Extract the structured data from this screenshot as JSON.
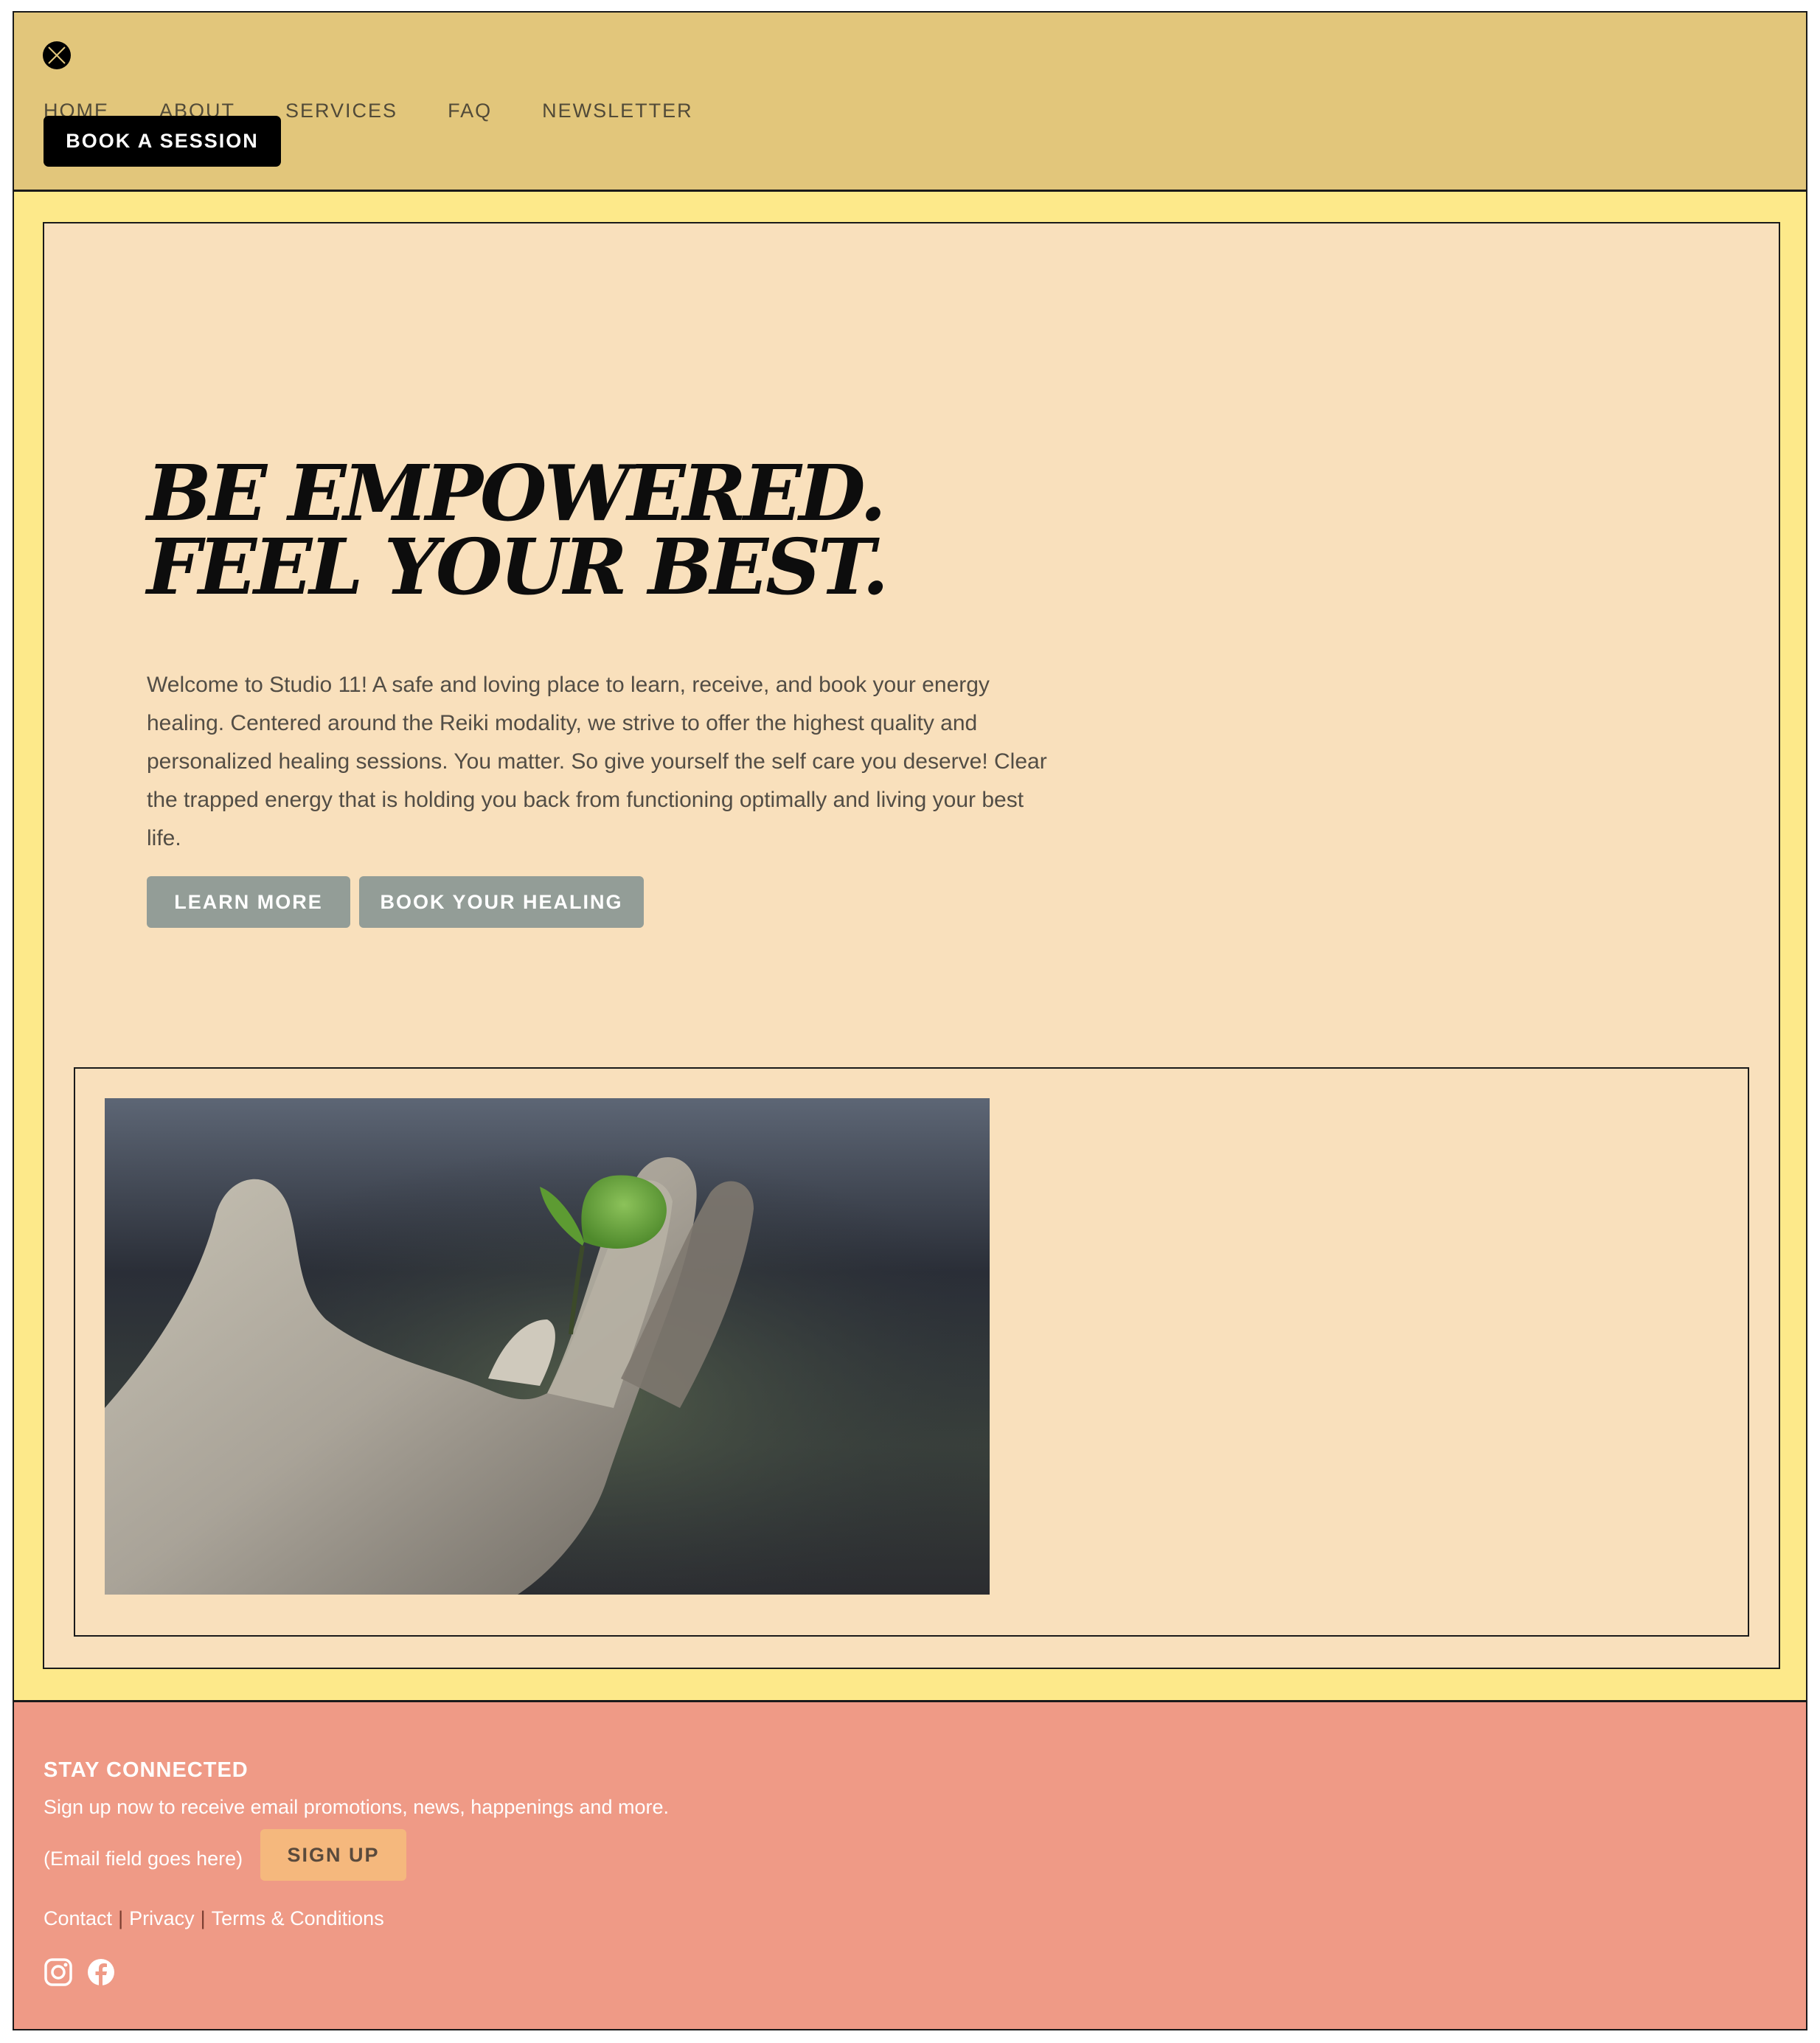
{
  "header": {
    "nav": [
      "HOME",
      "ABOUT",
      "SERVICES",
      "FAQ",
      "NEWSLETTER"
    ],
    "book_label": "BOOK A SESSION"
  },
  "hero": {
    "headline_line1": "BE EMPOWERED.",
    "headline_line2": "FEEL YOUR BEST.",
    "intro": "Welcome to Studio 11! A safe and loving place to learn, receive, and book your energy healing. Centered around the Reiki modality, we strive to offer the highest quality and personalized healing sessions. You matter. So give yourself the self care you deserve! Clear the trapped energy that is holding you back from functioning optimally and living your best life.",
    "learn_more": "LEARN MORE",
    "book_healing": "BOOK YOUR HEALING"
  },
  "footer": {
    "title": "STAY CONNECTED",
    "description": "Sign up now to receive email promotions, news, happenings and more.",
    "email_placeholder": "(Email field goes here)",
    "signup_label": "SIGN UP",
    "links": [
      "Contact",
      "Privacy",
      "Terms & Conditions"
    ],
    "social_icons": [
      "instagram-icon",
      "facebook-icon"
    ]
  },
  "colors": {
    "header_bg": "#e2c67b",
    "main_bg": "#fde98a",
    "hero_bg": "#f9e0bc",
    "footer_bg": "#ef9a86",
    "button_gray": "#939d97",
    "signup_bg": "#f5b87d"
  }
}
